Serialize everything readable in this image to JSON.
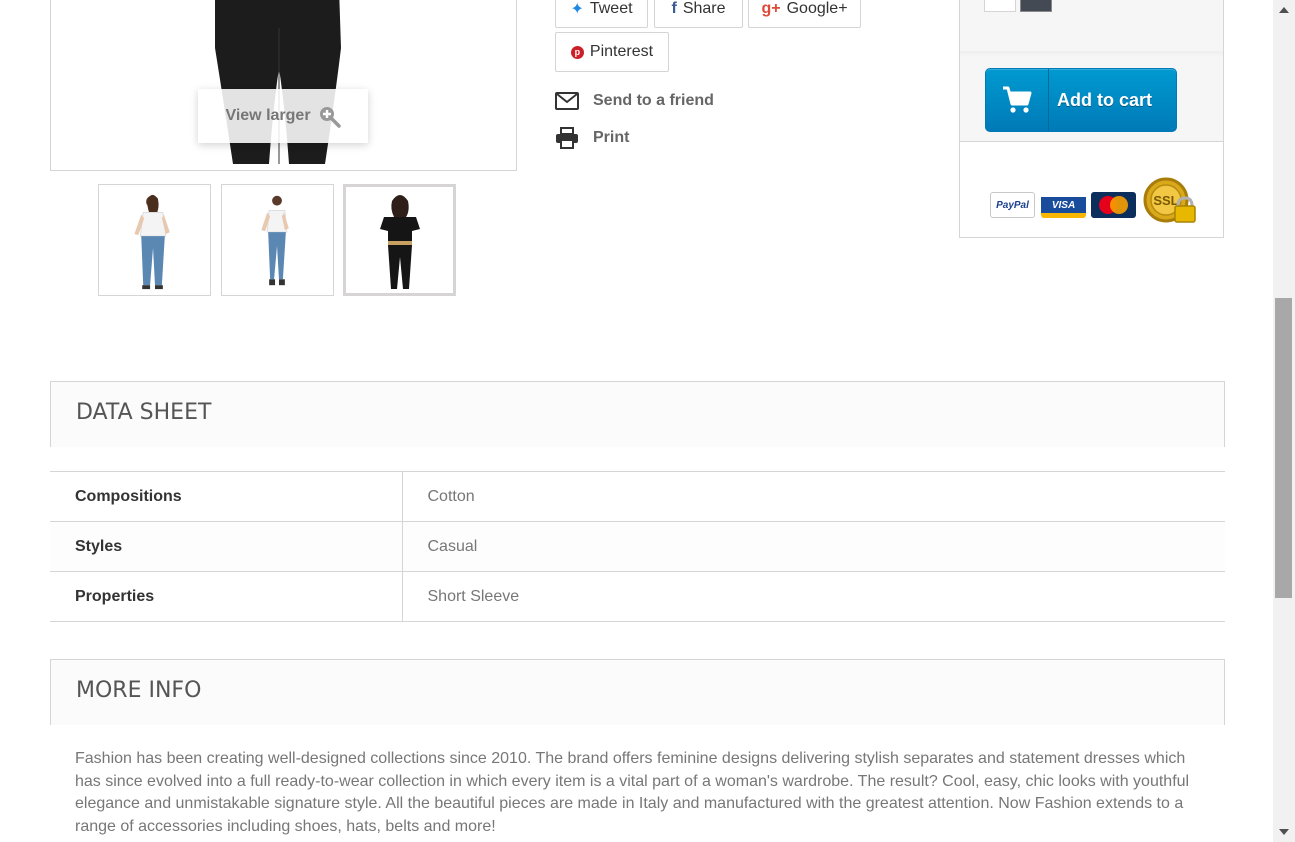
{
  "gallery": {
    "view_larger_label": "View larger",
    "thumbnails": [
      "thumb-white-top-jeans-front",
      "thumb-white-top-jeans-full",
      "thumb-black-top"
    ]
  },
  "share": {
    "tweet_label": "Tweet",
    "share_label": "Share",
    "googleplus_label": "Google+",
    "pinterest_label": "Pinterest"
  },
  "actions": {
    "send_to_friend": "Send to a friend",
    "print": "Print"
  },
  "buy_box": {
    "add_to_cart_label": "Add to cart",
    "payment_logos": [
      "PayPal",
      "VISA",
      "MasterCard",
      "SSL"
    ],
    "accent_color": "#009ad0"
  },
  "data_sheet": {
    "title": "DATA SHEET",
    "rows": [
      {
        "name": "Compositions",
        "value": "Cotton"
      },
      {
        "name": "Styles",
        "value": "Casual"
      },
      {
        "name": "Properties",
        "value": "Short Sleeve"
      }
    ]
  },
  "more_info": {
    "title": "MORE INFO",
    "text": "Fashion has been creating well-designed collections since 2010. The brand offers feminine designs delivering stylish separates and statement dresses which has since evolved into a full ready-to-wear collection in which every item is a vital part of a woman's wardrobe. The result? Cool, easy, chic looks with youthful elegance and unmistakable signature style. All the beautiful pieces are made in Italy and manufactured with the greatest attention. Now Fashion extends to a range of accessories including shoes, hats, belts and more!"
  }
}
